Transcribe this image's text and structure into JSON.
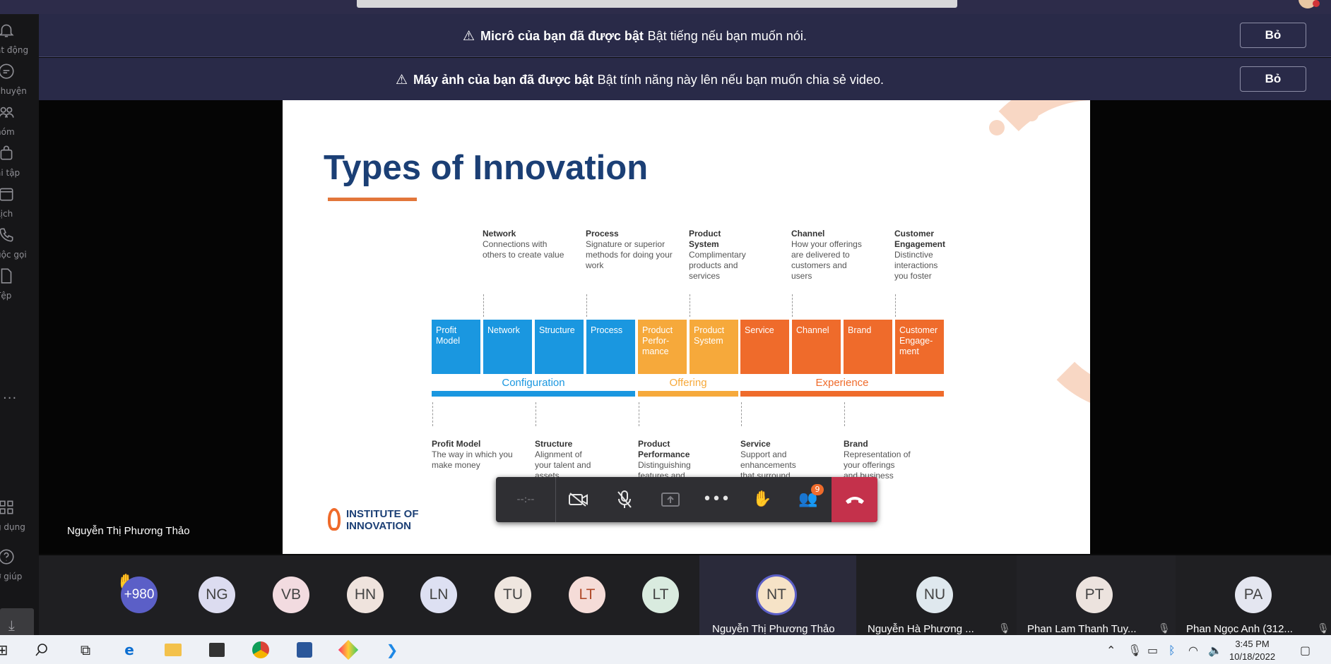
{
  "left_rail": {
    "items": [
      "ạt động",
      "chuyện",
      "hóm",
      "ài tập",
      "Lịch",
      "uộc gọi",
      "Tệp",
      "g dụng",
      "ợ giúp"
    ],
    "more": "···"
  },
  "banners": [
    {
      "bold": "Micrô của bạn đã được bật",
      "text": "Bật tiếng nếu bạn muốn nói.",
      "button": "Bỏ"
    },
    {
      "bold": "Máy ảnh của bạn đã được bật",
      "text": "Bật tính năng này lên nếu bạn muốn chia sẻ video.",
      "button": "Bỏ"
    }
  ],
  "slide": {
    "title": "Types of Innovation",
    "top_descriptions": [
      {
        "title": "Network",
        "text": "Connections with others to create value"
      },
      {
        "title": "Process",
        "text": "Signature or superior methods for doing your work"
      },
      {
        "title": "Product System",
        "text": "Complimentary products and services"
      },
      {
        "title": "Channel",
        "text": "How your offerings are delivered to customers and users"
      },
      {
        "title": "Customer Engagement",
        "text": "Distinctive interactions you foster"
      }
    ],
    "boxes": [
      "Profit Model",
      "Network",
      "Structure",
      "Process",
      "Product Perfor-mance",
      "Product System",
      "Service",
      "Channel",
      "Brand",
      "Customer Engage-ment"
    ],
    "categories": [
      "Configuration",
      "Offering",
      "Experience"
    ],
    "bottom_descriptions": [
      {
        "title": "Profit Model",
        "text": "The way in which you make money"
      },
      {
        "title": "Structure",
        "text": "Alignment of your talent and assets"
      },
      {
        "title": "Product Performance",
        "text": "Distinguishing features and"
      },
      {
        "title": "Service",
        "text": "Support and enhancements that surround"
      },
      {
        "title": "Brand",
        "text": "Representation of your offerings and business"
      }
    ],
    "logo": [
      "INSTITUTE OF",
      "INNOVATION"
    ],
    "colors": {
      "configuration": "#1a97e0",
      "offering": "#f6a93b",
      "experience": "#ef6b2b",
      "title": "#1b3f75"
    }
  },
  "presenter": "Nguyễn Thị Phương Thảo",
  "call_controls": {
    "timer": "--:--",
    "participants_badge": "9"
  },
  "participants": {
    "overflow": "+980",
    "avatars": [
      "NG",
      "VB",
      "HN",
      "LN",
      "TU",
      "LT",
      "LT"
    ],
    "tiles": [
      {
        "initials": "NT",
        "name": "Nguyễn Thị Phương Thảo"
      },
      {
        "initials": "NU",
        "name": "Nguyễn Hà Phương ..."
      },
      {
        "initials": "PT",
        "name": "Phan Lam Thanh Tuy..."
      },
      {
        "initials": "PA",
        "name": "Phan Ngọc Anh (312..."
      }
    ]
  },
  "taskbar": {
    "time": "3:45 PM",
    "date": "10/18/2022"
  }
}
